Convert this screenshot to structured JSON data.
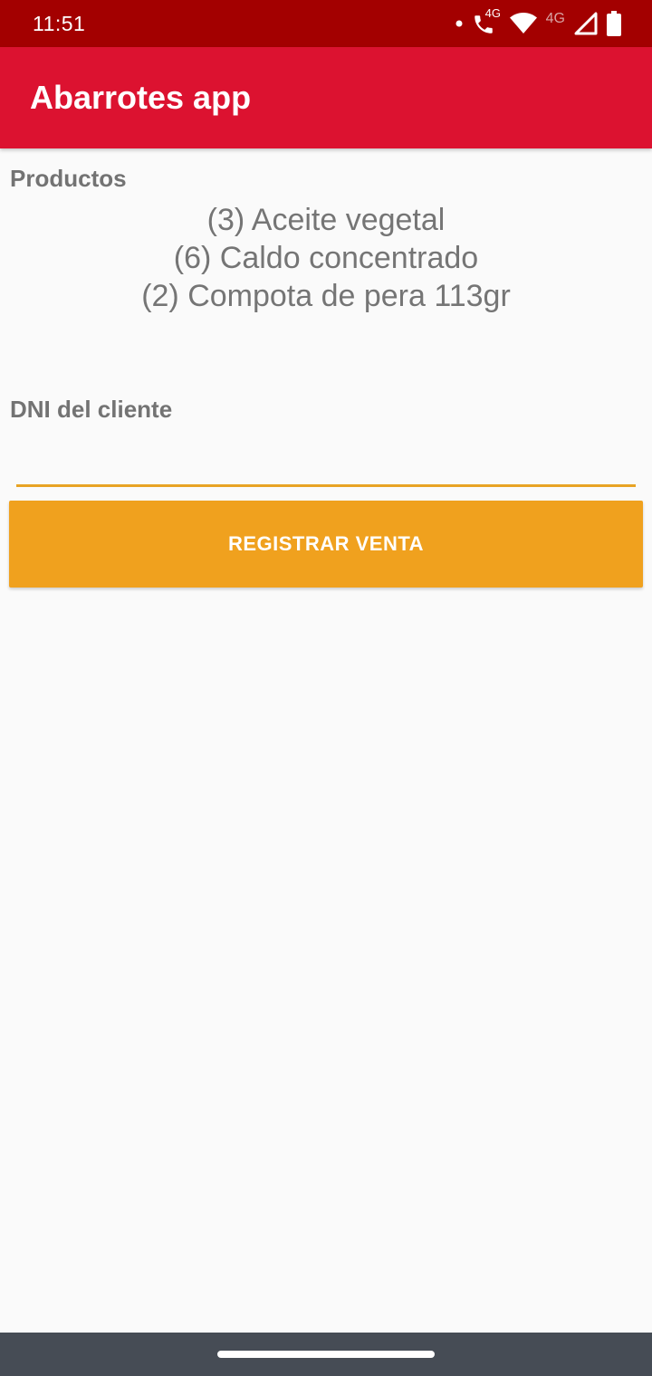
{
  "status_bar": {
    "time": "11:51",
    "network_label_1": "4G",
    "network_label_2": "4G",
    "icons": [
      "dot-icon",
      "wifi-calling-icon",
      "wifi-icon",
      "cell-signal-icon",
      "battery-icon"
    ]
  },
  "app_bar": {
    "title": "Abarrotes app"
  },
  "products": {
    "label": "Productos",
    "items": [
      "(3) Aceite vegetal",
      "(6) Caldo concentrado",
      "(2) Compota de pera 113gr"
    ]
  },
  "customer": {
    "label": "DNI del cliente",
    "value": "",
    "placeholder": ""
  },
  "register_button": {
    "label": "REGISTRAR VENTA"
  },
  "colors": {
    "status_bar": "#a30000",
    "app_bar": "#dc1230",
    "accent": "#f0a11e",
    "input_underline": "#e8a324",
    "nav_bar": "#464c55",
    "background": "#fafafa",
    "label_text": "#737373"
  }
}
